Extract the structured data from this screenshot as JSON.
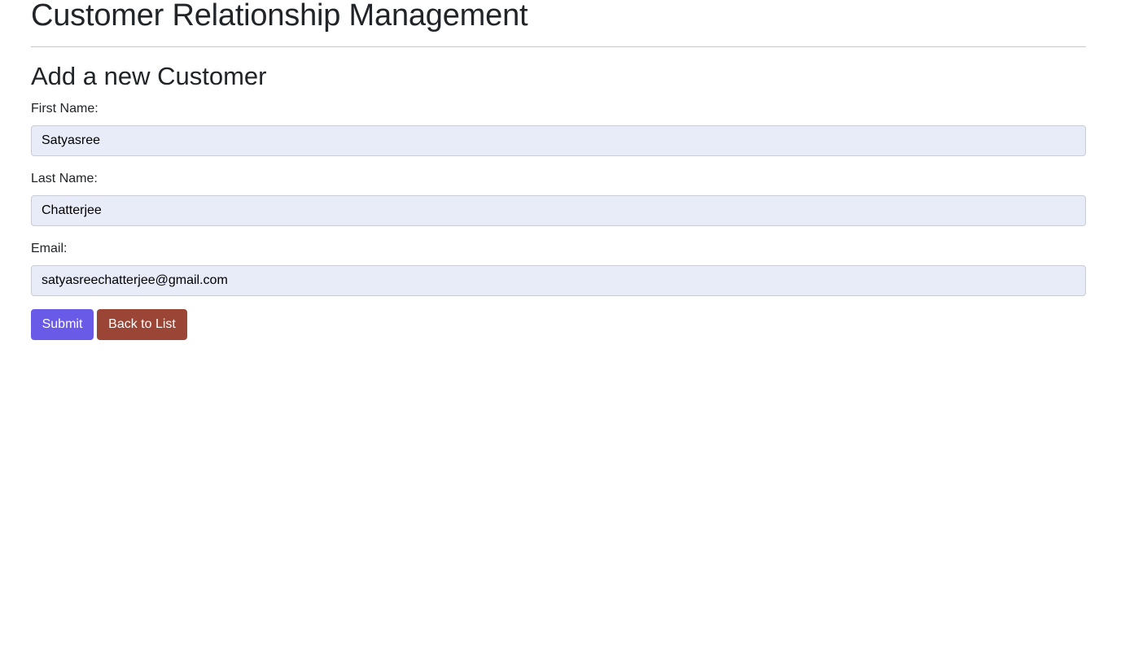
{
  "header": {
    "title": "Customer Relationship Management"
  },
  "form": {
    "title": "Add a new Customer",
    "fields": [
      {
        "label": "First Name:",
        "value": "Satyasree"
      },
      {
        "label": "Last Name:",
        "value": "Chatterjee"
      },
      {
        "label": "Email:",
        "value": "satyasreechatterjee@gmail.com"
      }
    ],
    "submit_label": "Submit",
    "back_label": "Back to List"
  },
  "colors": {
    "input_background": "#e8ebf8",
    "submit_button": "#6a5ae8",
    "back_button": "#9a4536"
  }
}
